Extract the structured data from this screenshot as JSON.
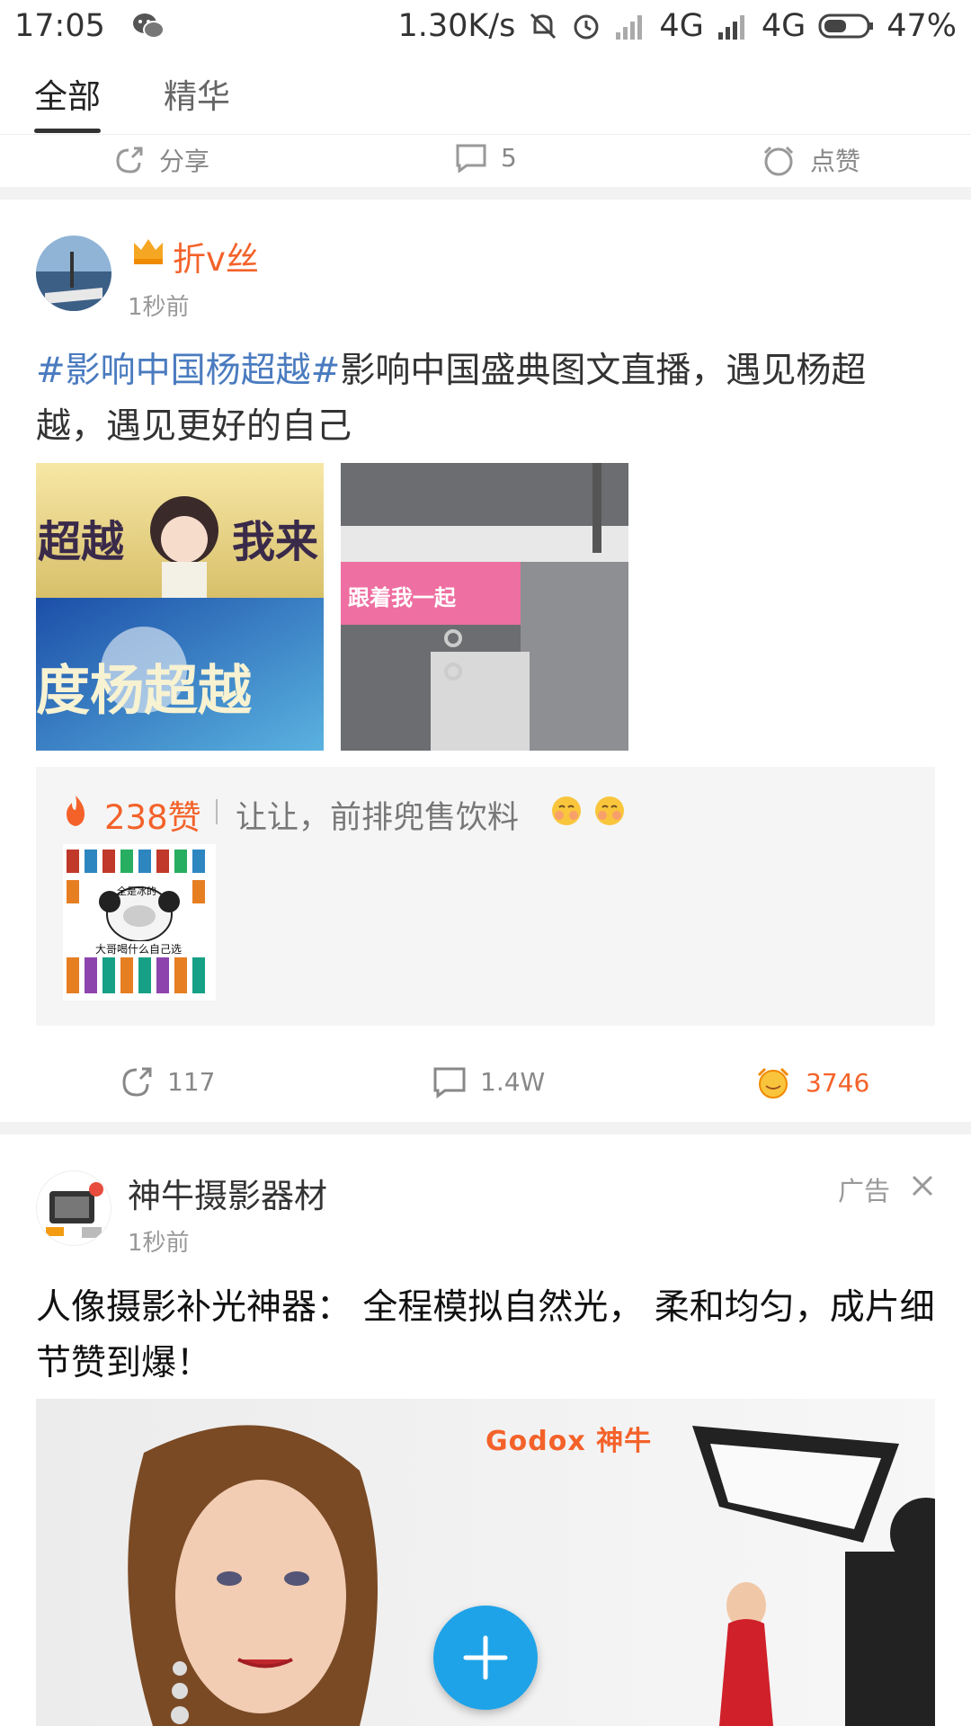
{
  "status_bar": {
    "time": "17:05",
    "speed": "1.30K/s",
    "net1": "4G",
    "net2": "4G",
    "battery": "47%"
  },
  "tabs": [
    {
      "label": "全部",
      "active": true
    },
    {
      "label": "精华",
      "active": false
    }
  ],
  "prev_post_actions": {
    "share_label": "分享",
    "comment_count": "5",
    "like_label": "点赞"
  },
  "post1": {
    "username": "折v丝",
    "time": "1秒前",
    "topic": "#影响中国杨超越#",
    "text": "影响中国盛典图文直播，遇见杨超越，遇见更好的自己",
    "images": [
      {
        "alt_text_1": "超越",
        "alt_text_2": "我来",
        "alt_text_3": "度杨超越"
      },
      {
        "banner_text": "跟着我一起"
      }
    ],
    "hot_comment": {
      "likes": "238赞",
      "text": "让让，前排兜售饮料",
      "sticker_top": "全是冰的",
      "sticker_bottom": "大哥喝什么自己选"
    },
    "actions": {
      "repost_count": "117",
      "comment_count": "1.4W",
      "like_count": "3746"
    }
  },
  "post2": {
    "username": "神牛摄影器材",
    "time": "1秒前",
    "ad_label": "广告",
    "text": "人像摄影补光神器： 全程模拟自然光， 柔和均匀，成片细节赞到爆！",
    "brand": "Godox 神牛"
  },
  "colors": {
    "accent_orange": "#f4622a",
    "topic_blue": "#4a7bbf",
    "fab_blue": "#1fa3e8"
  }
}
